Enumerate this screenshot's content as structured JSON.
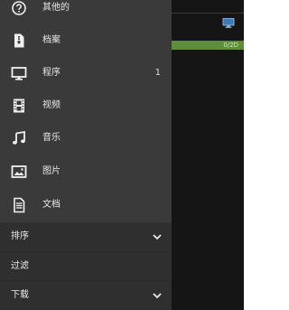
{
  "drawer": {
    "items": [
      {
        "label": "其他的",
        "icon": "help-circle-icon",
        "count": ""
      },
      {
        "label": "档案",
        "icon": "archive-file-icon",
        "count": ""
      },
      {
        "label": "程序",
        "icon": "monitor-icon",
        "count": "1"
      },
      {
        "label": "视频",
        "icon": "film-icon",
        "count": ""
      },
      {
        "label": "音乐",
        "icon": "music-note-icon",
        "count": ""
      },
      {
        "label": "图片",
        "icon": "image-icon",
        "count": ""
      },
      {
        "label": "文档",
        "icon": "document-icon",
        "count": ""
      }
    ],
    "sections": [
      {
        "label": "排序",
        "icon": "chevron-down-icon"
      },
      {
        "label": "过滤",
        "icon": ""
      },
      {
        "label": "下载",
        "icon": "chevron-down-icon"
      }
    ]
  },
  "background": {
    "badge_text": "0/2D"
  },
  "colors": {
    "drawer_bg": "#3a3a3a",
    "drawer_bottom_bg": "#2f2f2f",
    "background_app": "#151515",
    "badge_green": "#5f8e38",
    "icon_white": "#f0f0f0"
  }
}
